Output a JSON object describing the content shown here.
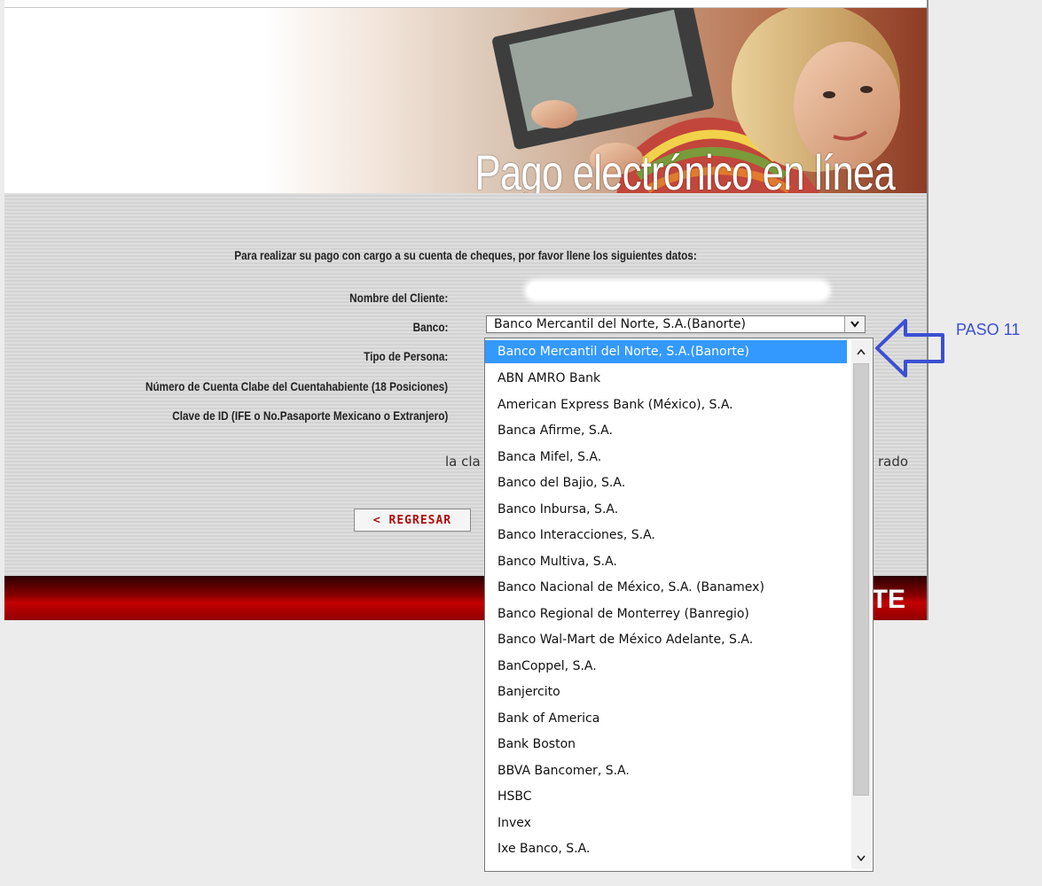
{
  "banner": {
    "title": "Pago electrónico en línea"
  },
  "form": {
    "intro": "Para realizar su pago con cargo a su cuenta de cheques, por favor llene los siguientes datos:",
    "labels": {
      "nombre": "Nombre del Cliente:",
      "banco": "Banco:",
      "tipo_persona": "Tipo de Persona:",
      "cuenta_clabe": "Número de Cuenta Clabe del Cuentahabiente (18 Posiciones)",
      "clave_id": "Clave de ID (IFE o No.Pasaporte Mexicano o Extranjero)"
    },
    "banco_selected": "Banco Mercantil del Norte, S.A.(Banorte)",
    "partial_text_left": "la cla",
    "partial_text_right": "rado",
    "back_button": "< REGRESAR"
  },
  "footer": {
    "logo_fragment": "TE"
  },
  "dropdown": {
    "options": [
      "Banco Mercantil del Norte, S.A.(Banorte)",
      "ABN AMRO Bank",
      "American Express Bank (México), S.A.",
      "Banca Afirme, S.A.",
      "Banca Mifel, S.A.",
      "Banco del Bajio, S.A.",
      "Banco Inbursa, S.A.",
      "Banco Interacciones, S.A.",
      "Banco Multiva, S.A.",
      "Banco Nacional de México, S.A. (Banamex)",
      "Banco Regional de Monterrey (Banregio)",
      "Banco Wal-Mart de México Adelante, S.A.",
      "BanCoppel, S.A.",
      "Banjercito",
      "Bank of America",
      "Bank Boston",
      "BBVA Bancomer, S.A.",
      "HSBC",
      "Invex",
      "Ixe Banco, S.A."
    ]
  },
  "annotation": {
    "label": "PASO 11",
    "color": "#3b4fd3"
  }
}
